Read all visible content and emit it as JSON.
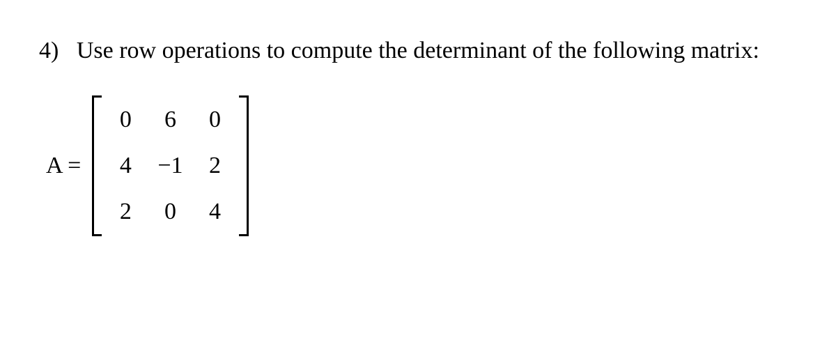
{
  "problem": {
    "number": "4)",
    "text": "Use row operations to compute the determinant of the following matrix:"
  },
  "equation": {
    "label": "A ="
  },
  "matrix": {
    "r0c0": "0",
    "r0c1": "6",
    "r0c2": "0",
    "r1c0": "4",
    "r1c1": "−1",
    "r1c2": "2",
    "r2c0": "2",
    "r2c1": "0",
    "r2c2": "4"
  }
}
